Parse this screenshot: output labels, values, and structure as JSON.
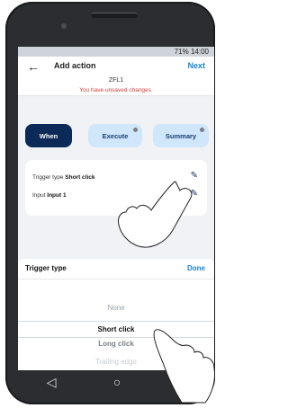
{
  "status": {
    "text": "71% 14:00"
  },
  "appbar": {
    "back_icon": "back-arrow-icon",
    "title": "Add action",
    "next_label": "Next"
  },
  "device": {
    "name": "ZFL1"
  },
  "notice": {
    "text": "You have unsaved changes."
  },
  "tabs": [
    {
      "label": "When"
    },
    {
      "label": "Execute"
    },
    {
      "label": "Summary"
    }
  ],
  "card": {
    "trigger_label": "Trigger type",
    "trigger_value": "Short click",
    "input_label": "Input",
    "input_value": "Input 1"
  },
  "sheet": {
    "title": "Trigger type",
    "done_label": "Done",
    "options": [
      "None",
      "Short click",
      "Long click",
      "Trailing edge"
    ],
    "selected": "Short click"
  }
}
